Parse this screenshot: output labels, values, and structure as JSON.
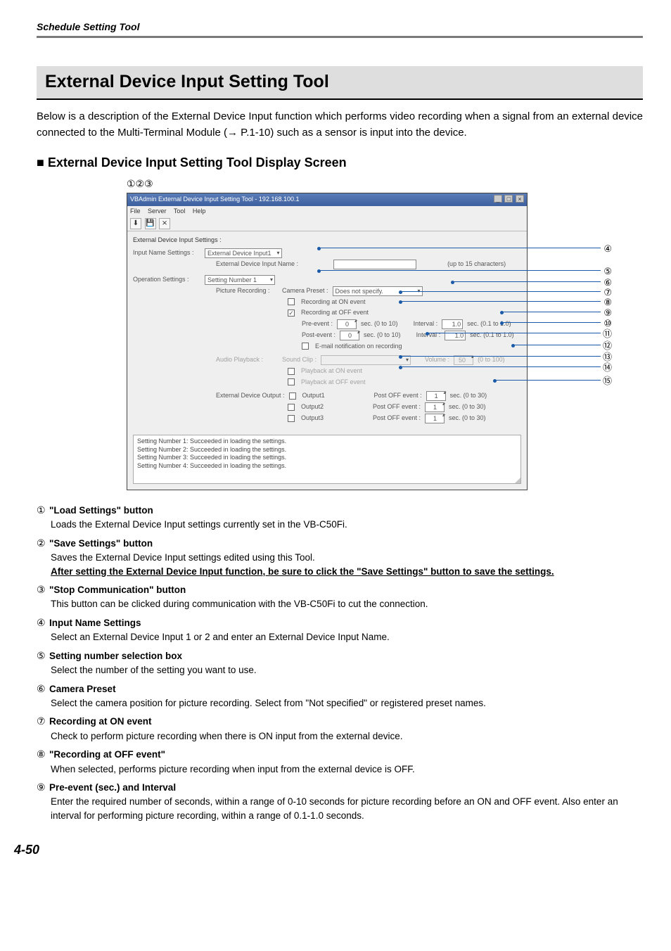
{
  "header": {
    "section_label": "Schedule Setting Tool"
  },
  "title": "External Device Input Setting Tool",
  "intro": "Below is a description of the External Device Input function which performs video recording when a signal from an external device connected to the Multi-Terminal Module (→ P.1-10) such as a sensor is input into the device.",
  "section_heading_prefix": "■ ",
  "section_heading": "External Device Input Setting Tool Display Screen",
  "circled_top": {
    "c1": "①",
    "c2": "②",
    "c3": "③"
  },
  "window": {
    "title": "VBAdmin External Device Input Setting Tool - 192.168.100.1",
    "menu": {
      "file": "File",
      "server": "Server",
      "tool": "Tool",
      "help": "Help"
    },
    "panel_title": "External Device Input Settings :",
    "input_name_settings_label": "Input Name Settings :",
    "input_name_settings_value": "External Device Input1",
    "ext_dev_input_name_label": "External Device Input Name :",
    "ext_dev_input_name_hint": "(up to 15 characters)",
    "operation_settings_label": "Operation Settings :",
    "operation_settings_value": "Setting Number 1",
    "picture_recording_label": "Picture Recording :",
    "camera_preset_label": "Camera Preset :",
    "camera_preset_value": "Does not specify.",
    "rec_on_label": "Recording at ON event",
    "rec_off_label": "Recording at OFF event",
    "pre_event_label": "Pre-event :",
    "post_event_label": "Post-event :",
    "sec_range": "sec. (0 to 10)",
    "interval_label": "Interval :",
    "interval_range": "sec. (0.1 to 1.0)",
    "pre_val": "0",
    "post_val": "0",
    "interval_val": "1.0",
    "email_label": "E-mail notification on recording",
    "audio_playback_label": "Audio Playback :",
    "sound_clip_label": "Sound Clip :",
    "volume_label": "Volume :",
    "volume_range": "(0 to 100)",
    "volume_val": "50",
    "play_on_label": "Playback at ON event",
    "play_off_label": "Playback at OFF event",
    "ext_dev_output_label": "External Device Output :",
    "out1": "Output1",
    "out2": "Output2",
    "out3": "Output3",
    "post_off_label": "Post OFF event :",
    "post_off_range": "sec. (0 to 30)",
    "post_off_val": "1",
    "status_lines": [
      "Setting Number 1: Succeeded in loading the settings.",
      "Setting Number 2: Succeeded in loading the settings.",
      "Setting Number 3: Succeeded in loading the settings.",
      "Setting Number 4: Succeeded in loading the settings."
    ]
  },
  "callouts": {
    "c4": "④",
    "c5": "⑤",
    "c6": "⑥",
    "c7": "⑦",
    "c8": "⑧",
    "c9": "⑨",
    "c10": "⑩",
    "c11": "⑪",
    "c12": "⑫",
    "c13": "⑬",
    "c14": "⑭",
    "c15": "⑮"
  },
  "descriptions": [
    {
      "num": "①",
      "label": "\"Load Settings\" button",
      "body": [
        "Loads the External Device Input settings currently set in the VB-C50Fi."
      ]
    },
    {
      "num": "②",
      "label": "\"Save Settings\" button",
      "body": [
        "Saves the External Device Input settings edited using this Tool."
      ],
      "body_underline": "After setting the External Device Input function, be sure to click the \"Save Settings\" button to save the settings."
    },
    {
      "num": "③",
      "label": "\"Stop Communication\" button",
      "body": [
        "This button can be clicked during communication with the VB-C50Fi to cut the connection."
      ]
    },
    {
      "num": "④",
      "label": "Input Name Settings",
      "body": [
        "Select an External Device Input 1 or 2 and enter an External Device Input Name."
      ]
    },
    {
      "num": "⑤",
      "label": "Setting number selection box",
      "body": [
        "Select the number of the setting you want to use."
      ]
    },
    {
      "num": "⑥",
      "label": "Camera Preset",
      "body": [
        "Select the camera position for picture recording. Select from \"Not specified\" or registered preset names."
      ]
    },
    {
      "num": "⑦",
      "label": "Recording at ON event",
      "body": [
        "Check to perform picture recording when there is ON input from the external device."
      ]
    },
    {
      "num": "⑧",
      "label": "\"Recording at OFF event\"",
      "body": [
        "When selected, performs picture recording when input from the external device is OFF."
      ]
    },
    {
      "num": "⑨",
      "label": "Pre-event (sec.) and Interval",
      "body": [
        "Enter the required number of seconds, within a range of 0-10 seconds for picture recording before an ON and OFF event. Also enter an interval for performing picture recording, within a range of 0.1-1.0 seconds."
      ]
    }
  ],
  "page_number": "4-50"
}
